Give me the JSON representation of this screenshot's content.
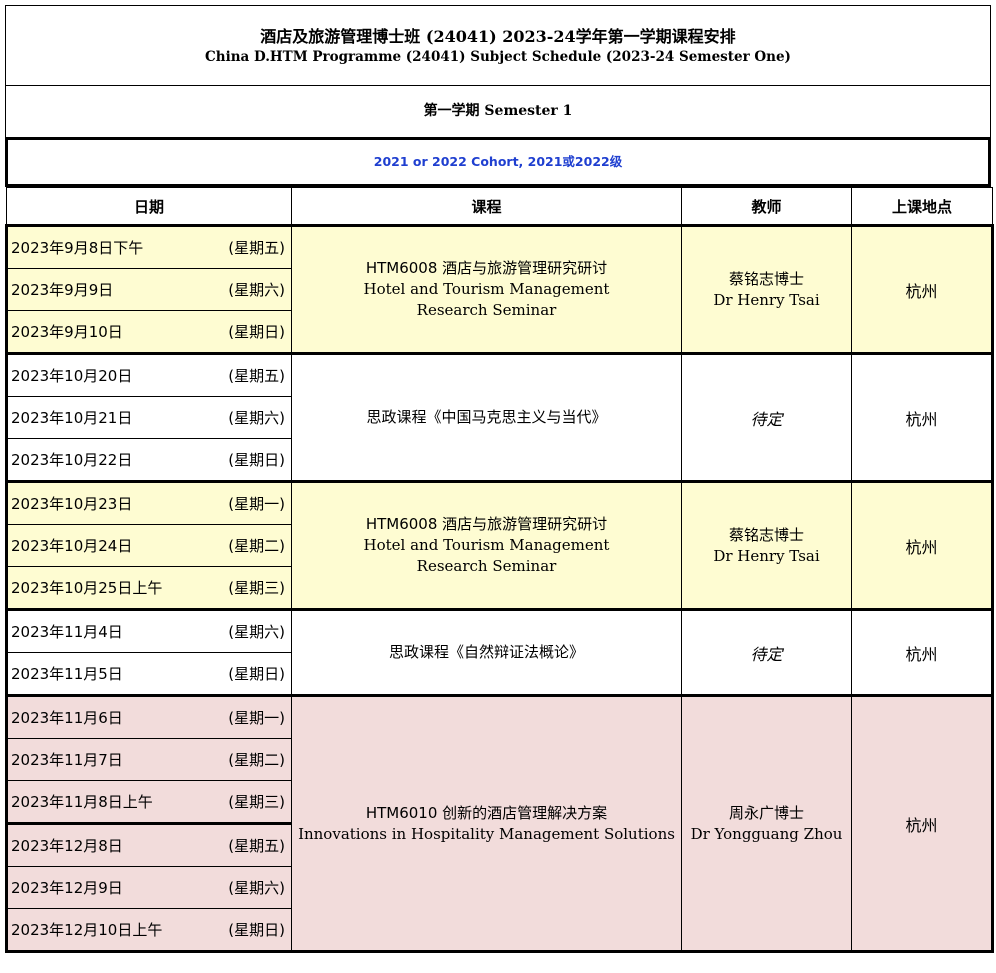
{
  "header": {
    "title_cn": "酒店及旅游管理博士班 (24041) 2023-24学年第一学期课程安排",
    "title_en": "China D.HTM Programme (24041) Subject Schedule (2023-24 Semester One)",
    "semester": "第一学期 Semester 1",
    "cohort": "2021 or 2022 Cohort, 2021或2022级"
  },
  "columns": {
    "date": "日期",
    "course": "课程",
    "teacher": "教师",
    "location": "上课地点"
  },
  "blocks": [
    {
      "color": "#fefcd2",
      "course_cn": "HTM6008 酒店与旅游管理研究研讨",
      "course_en": "Hotel and Tourism Management Research Seminar",
      "teacher_cn": "蔡铭志博士",
      "teacher_en": "Dr Henry Tsai",
      "location": "杭州",
      "dates": [
        {
          "date": "2023年9月8日下午",
          "weekday": "(星期五)"
        },
        {
          "date": "2023年9月9日",
          "weekday": "(星期六)"
        },
        {
          "date": "2023年9月10日",
          "weekday": "(星期日)"
        }
      ]
    },
    {
      "color": "#ffffff",
      "course_cn": "思政课程《中国马克思主义与当代》",
      "teacher_cn": "待定",
      "location": "杭州",
      "dates": [
        {
          "date": "2023年10月20日",
          "weekday": "(星期五)"
        },
        {
          "date": "2023年10月21日",
          "weekday": "(星期六)"
        },
        {
          "date": "2023年10月22日",
          "weekday": "(星期日)"
        }
      ]
    },
    {
      "color": "#fefcd2",
      "course_cn": "HTM6008 酒店与旅游管理研究研讨",
      "course_en": "Hotel and Tourism Management Research Seminar",
      "teacher_cn": "蔡铭志博士",
      "teacher_en": "Dr Henry Tsai",
      "location": "杭州",
      "dates": [
        {
          "date": "2023年10月23日",
          "weekday": "(星期一)"
        },
        {
          "date": "2023年10月24日",
          "weekday": "(星期二)"
        },
        {
          "date": "2023年10月25日上午",
          "weekday": "(星期三)"
        }
      ]
    },
    {
      "color": "#ffffff",
      "course_cn": "思政课程《自然辩证法概论》",
      "teacher_cn": "待定",
      "location": "杭州",
      "dates": [
        {
          "date": "2023年11月4日",
          "weekday": "(星期六)"
        },
        {
          "date": "2023年11月5日",
          "weekday": "(星期日)"
        }
      ]
    },
    {
      "color": "#f2dcdb",
      "course_cn": "HTM6010 创新的酒店管理解决方案",
      "course_en": "Innovations in Hospitality Management Solutions",
      "teacher_cn": "周永广博士",
      "teacher_en": "Dr Yongguang Zhou",
      "location": "杭州",
      "dates": [
        {
          "date": "2023年11月6日",
          "weekday": "(星期一)"
        },
        {
          "date": "2023年11月7日",
          "weekday": "(星期二)"
        },
        {
          "date": "2023年11月8日上午",
          "weekday": "(星期三)"
        },
        {
          "date": "2023年12月8日",
          "weekday": "(星期五)"
        },
        {
          "date": "2023年12月9日",
          "weekday": "(星期六)"
        },
        {
          "date": "2023年12月10日上午",
          "weekday": "(星期日)"
        }
      ]
    }
  ]
}
